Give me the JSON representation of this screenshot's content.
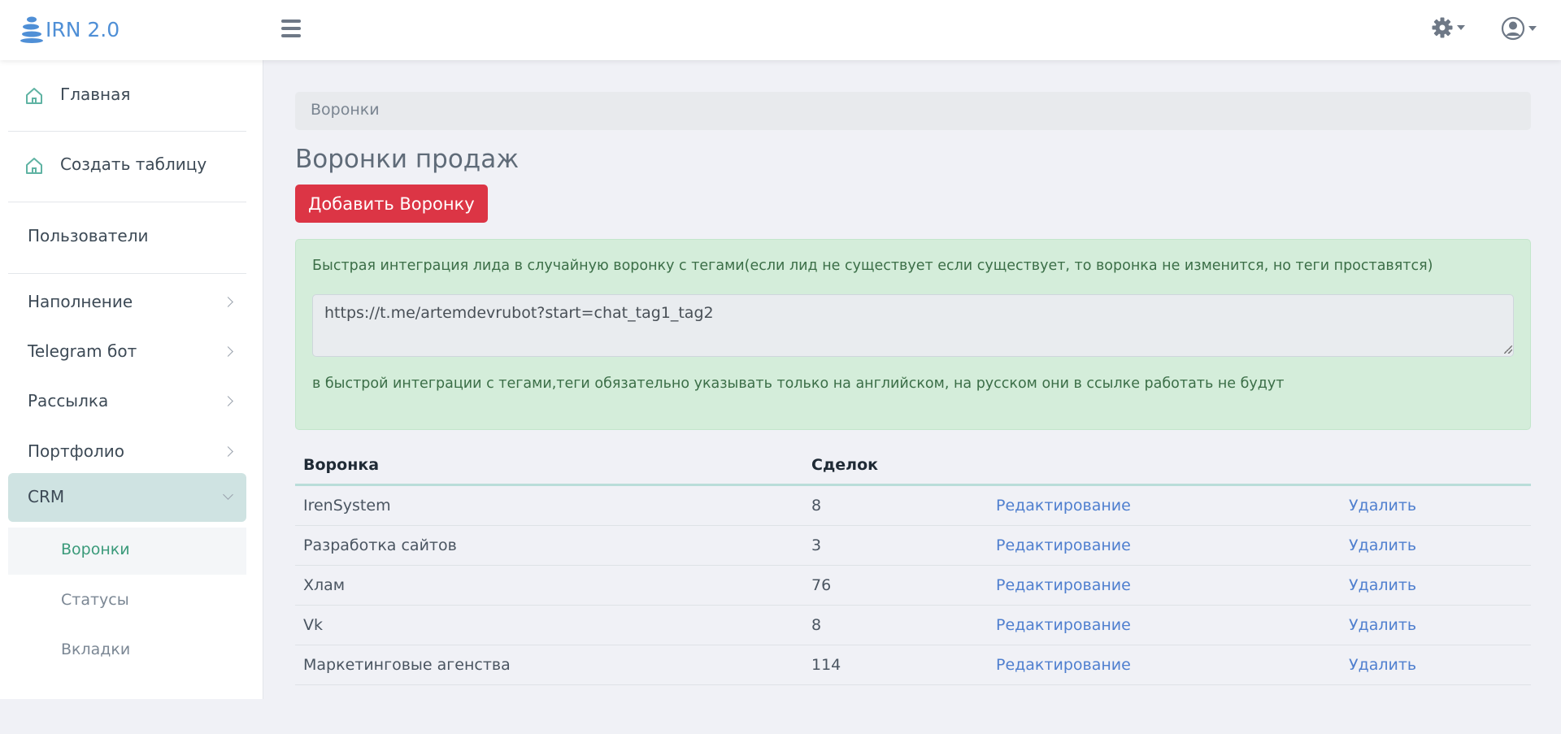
{
  "header": {
    "logo_text": "IRN 2.0",
    "icons": [
      "stack-icon",
      "menu-icon",
      "gear-icon",
      "user-circle-icon"
    ]
  },
  "sidebar": {
    "items": [
      {
        "label": "Главная",
        "icon": "home-icon"
      },
      {
        "label": "Создать таблицу",
        "icon": "home-icon"
      },
      {
        "label": "Пользователи"
      },
      {
        "label": "Наполнение",
        "expandable": true
      },
      {
        "label": "Telegram бот",
        "expandable": true
      },
      {
        "label": "Рассылка",
        "expandable": true
      },
      {
        "label": "Портфолио",
        "expandable": true
      },
      {
        "label": "CRM",
        "expanded": true,
        "active": true
      }
    ],
    "crm_sub_items": [
      {
        "label": "Воронки",
        "active": true
      },
      {
        "label": "Статусы"
      },
      {
        "label": "Вкладки"
      }
    ]
  },
  "main": {
    "breadcrumb": "Воронки",
    "title": "Воронки продаж",
    "add_button": "Добавить Воронку",
    "alert": {
      "text1": "Быстрая интеграция лида в случайную воронку с тегами(если лид не существует если существует, то воронка не изменится, но теги проставятся)",
      "link_value": "https://t.me/artemdevrubot?start=chat_tag1_tag2",
      "text2": "в быстрой интеграции с тегами,теги обязательно указывать только на английском, на русском они в ссылке работать не будут"
    },
    "table": {
      "headers": [
        "Воронка",
        "Сделок"
      ],
      "edit_label": "Редактирование",
      "delete_label": "Удалить",
      "rows": [
        {
          "name": "IrenSystem",
          "deals": "8"
        },
        {
          "name": "Разработка сайтов",
          "deals": "3"
        },
        {
          "name": "Хлам",
          "deals": "76"
        },
        {
          "name": "Vk",
          "deals": "8"
        },
        {
          "name": "Маркетинговые агенства",
          "deals": "114"
        }
      ]
    }
  },
  "colors": {
    "accent_blue": "#4f8fd6",
    "danger": "#dc3545",
    "alert_bg": "#d4edda",
    "active_bg": "#cfe3e2",
    "link": "#4f7fcf"
  }
}
